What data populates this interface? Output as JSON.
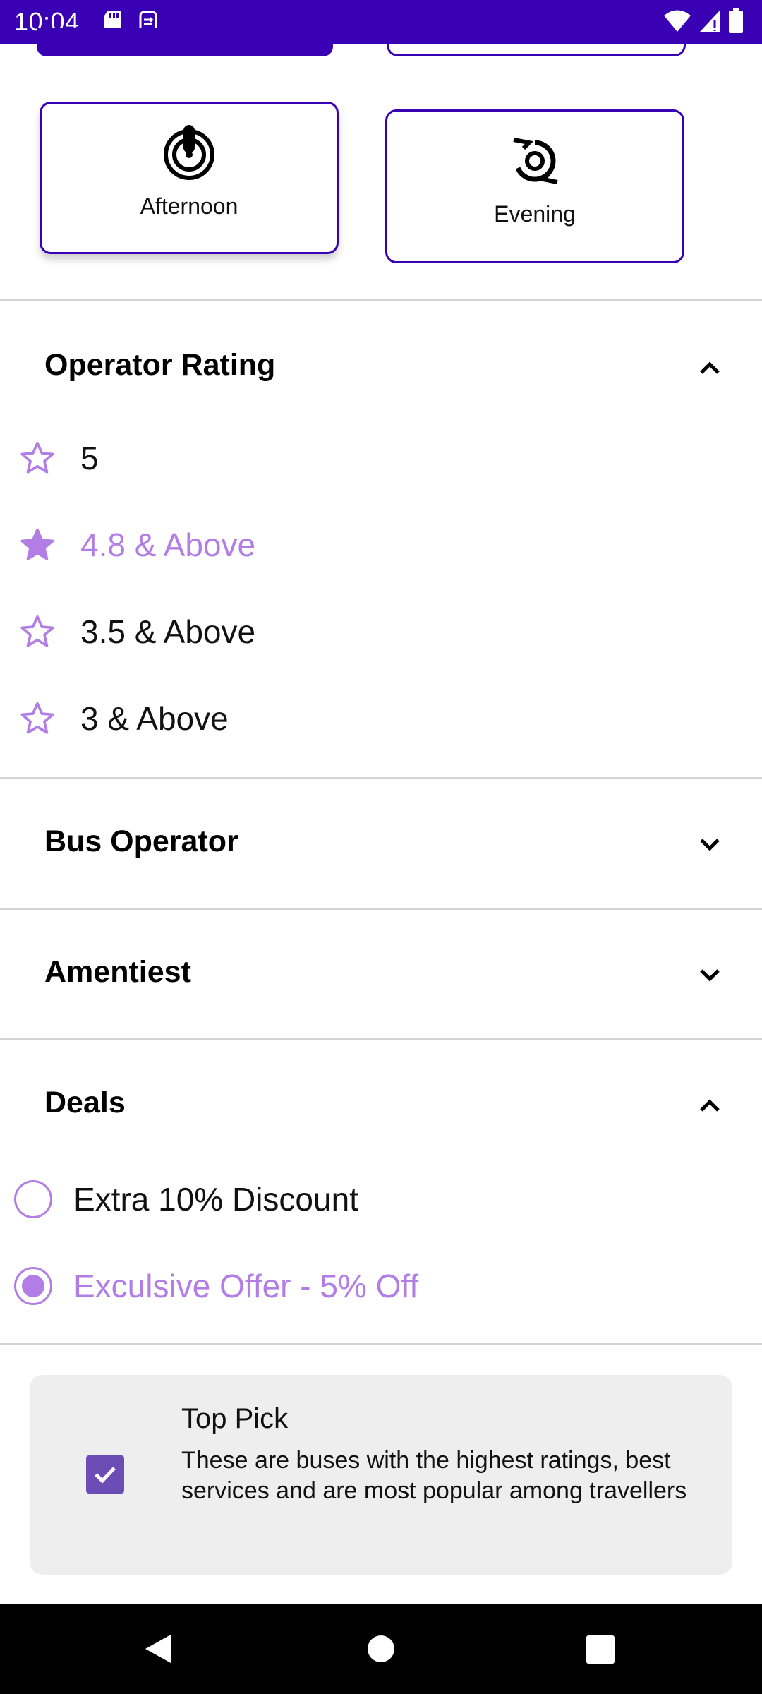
{
  "status_bar": {
    "time": "10:04",
    "left_icons": [
      "sd-card-icon",
      "sync-icon"
    ],
    "right_icons": [
      "wifi-icon",
      "signal-icon",
      "battery-icon"
    ]
  },
  "time_slots": {
    "cards": [
      {
        "label": "Afternoon",
        "icon": "afternoon-icon",
        "selected": true
      },
      {
        "label": "Evening",
        "icon": "evening-icon",
        "selected": false
      }
    ]
  },
  "operator_rating": {
    "title": "Operator Rating",
    "expanded": true,
    "options": [
      {
        "label": "5",
        "selected": false
      },
      {
        "label": "4.8 & Above",
        "selected": true
      },
      {
        "label": "3.5 & Above",
        "selected": false
      },
      {
        "label": "3 & Above",
        "selected": false
      }
    ]
  },
  "bus_operator": {
    "title": "Bus Operator",
    "expanded": false
  },
  "amenities": {
    "title": "Amentiest",
    "expanded": false
  },
  "deals": {
    "title": "Deals",
    "expanded": true,
    "options": [
      {
        "label": "Extra 10% Discount",
        "selected": false
      },
      {
        "label": "Exculsive Offer - 5% Off",
        "selected": true
      }
    ]
  },
  "top_pick": {
    "checked": true,
    "title": "Top Pick",
    "description": "These are buses with the highest ratings, best services and are most popular among travellers"
  },
  "colors": {
    "primary": "#3a00b3",
    "accent": "#b27ee6",
    "checkbox": "#6b4db5",
    "card_bg": "#eeeeee"
  },
  "nav_bar": [
    "back-icon",
    "home-icon",
    "recents-icon"
  ]
}
